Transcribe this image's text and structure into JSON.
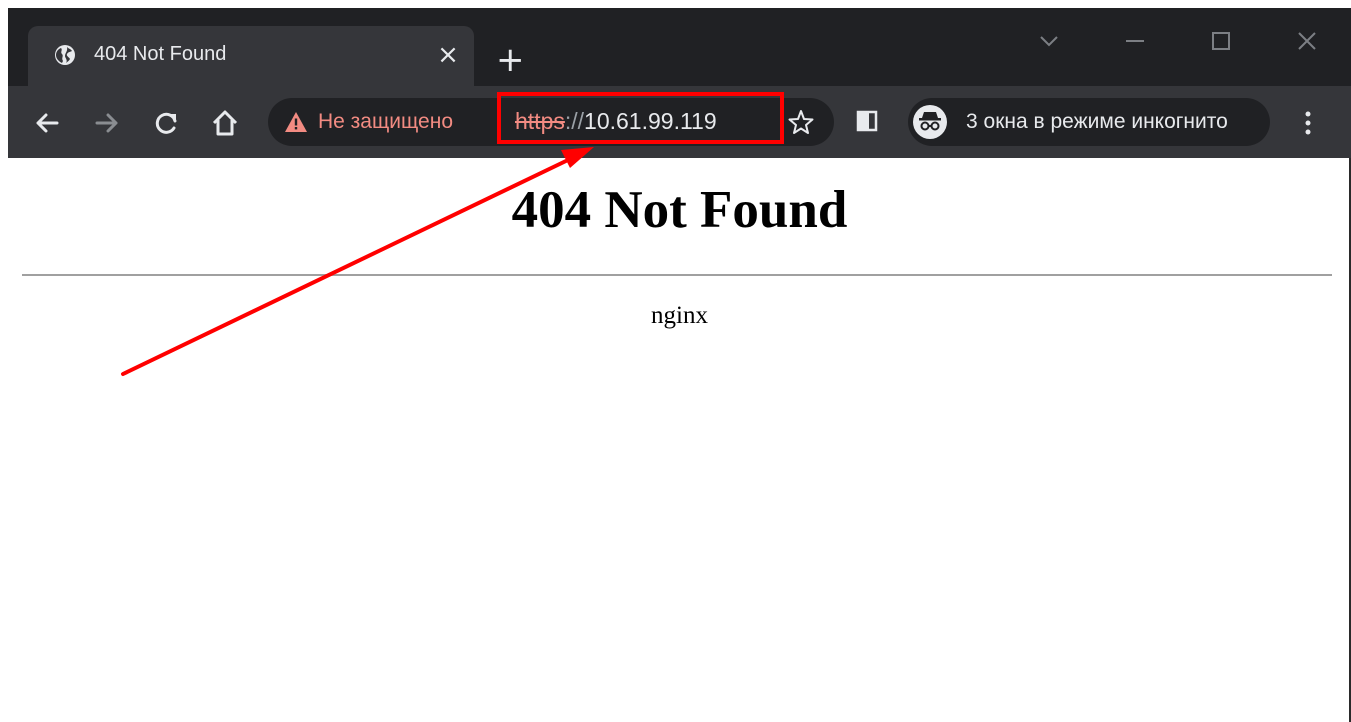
{
  "tab": {
    "title": "404 Not Found",
    "favicon": "globe-icon",
    "close_label": "×"
  },
  "new_tab_label": "+",
  "omnibox": {
    "security_label": "Не защищено",
    "url_scheme": "https",
    "url_separator": "://",
    "url_host": "10.61.99.119"
  },
  "incognito": {
    "label": "3 окна в режиме инкогнито",
    "icon": "incognito-icon"
  },
  "page": {
    "heading": "404 Not Found",
    "server_signature": "nginx"
  },
  "colors": {
    "tabstrip": "#202124",
    "toolbar": "#35363a",
    "warning": "#f28b82",
    "annotation": "#ff0000"
  }
}
